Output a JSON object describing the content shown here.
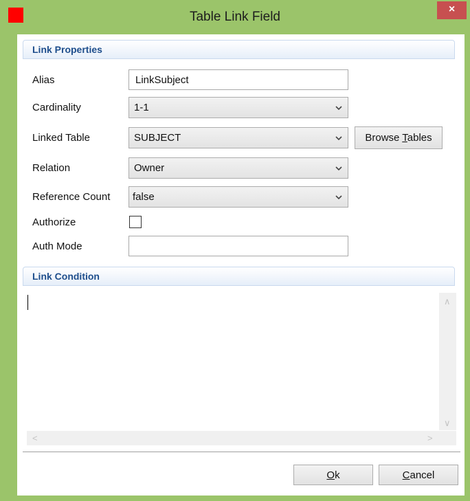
{
  "window": {
    "title": "Table Link Field",
    "close_glyph": "×"
  },
  "link_properties": {
    "header": "Link Properties",
    "alias_label": "Alias",
    "alias_value": "LinkSubject",
    "cardinality_label": "Cardinality",
    "cardinality_value": "1-1",
    "linked_table_label": "Linked Table",
    "linked_table_value": "SUBJECT",
    "browse_tables_pre": "Browse ",
    "browse_tables_mnemonic": "T",
    "browse_tables_post": "ables",
    "relation_label": "Relation",
    "relation_value": "Owner",
    "reference_count_label": "Reference Count",
    "reference_count_value": "false",
    "authorize_label": "Authorize",
    "authorize_checked": false,
    "auth_mode_label": "Auth Mode",
    "auth_mode_value": ""
  },
  "link_condition": {
    "header": "Link Condition",
    "text": ""
  },
  "footer": {
    "ok_mnemonic": "O",
    "ok_rest": "k",
    "cancel_mnemonic": "C",
    "cancel_rest": "ancel"
  },
  "colors": {
    "titlebar": "#9bc46a",
    "app_icon": "#ff0000",
    "close_button": "#c75050",
    "section_header_text": "#1e4e8c"
  },
  "icons": {
    "app": "app-square-icon",
    "close": "close-icon",
    "dropdown": "chevron-down-icon"
  }
}
